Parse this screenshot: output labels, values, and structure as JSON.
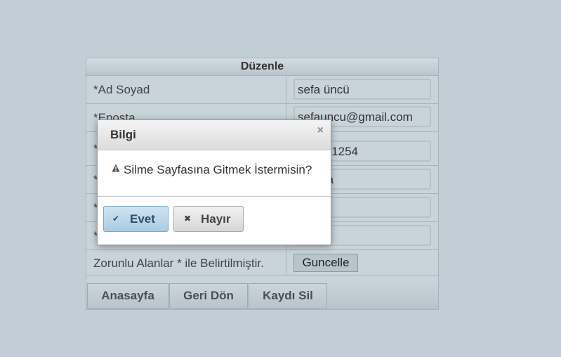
{
  "form": {
    "title": "Düzenle",
    "rows": [
      {
        "label": "*Ad Soyad",
        "value": "sefa üncü"
      },
      {
        "label": "*Eposta",
        "value": "sefauncu@gmail.com"
      },
      {
        "label": "*",
        "value": "...267-1254"
      },
      {
        "label": "*",
        "value": "...paşa"
      },
      {
        "label": "*",
        "value": ""
      },
      {
        "label": "*",
        "value": ""
      }
    ],
    "required_note": "Zorunlu Alanlar * ile Belirtilmiştir.",
    "update_button": "Guncelle"
  },
  "nav": {
    "home": "Anasayfa",
    "back": "Geri Dön",
    "delete": "Kaydı Sil"
  },
  "dialog": {
    "title": "Bilgi",
    "close_glyph": "×",
    "message": "Silme Sayfasına Gitmek İstermisin?",
    "yes_label": "Evet",
    "no_label": "Hayır",
    "yes_icon": "check-icon",
    "no_icon": "close-icon"
  }
}
